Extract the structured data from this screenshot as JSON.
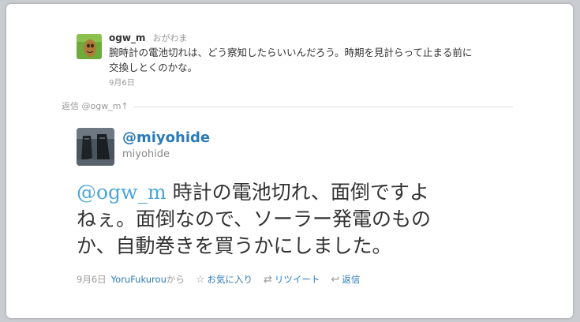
{
  "parent": {
    "username": "ogw_m",
    "display_name": "おがわま",
    "text_line1": "腕時計の電池切れは、どう察知したらいいんだろう。時期を見計らって止まる前に",
    "text_line2": "交換しとくのかな。",
    "date": "9月6日",
    "avatar_icon": "spoon-avatar-icon"
  },
  "reply_context": {
    "label": "返信 @ogw_m",
    "arrow": "↑"
  },
  "tweet": {
    "handle": "@miyohide",
    "display_name": "miyohide",
    "mention": "@ogw_m",
    "text_line1_rest": " 時計の電池切れ、面倒ですよ",
    "text_line2": "ねぇ。面倒なので、ソーラー発電のもの",
    "text_line3": "か、自動巻きを買うかにしました。",
    "date": "9月6日",
    "source": "YoruFukurou",
    "source_suffix": "から",
    "favorite_label": "お気に入り",
    "retweet_label": "リツイート",
    "reply_label": "返信",
    "favorite_icon": "☆",
    "retweet_icon": "⇄",
    "reply_icon": "↩"
  },
  "colors": {
    "link": "#2a7ab8",
    "mention": "#4ca6d8",
    "muted": "#999999",
    "background": "#c9ccd0"
  }
}
